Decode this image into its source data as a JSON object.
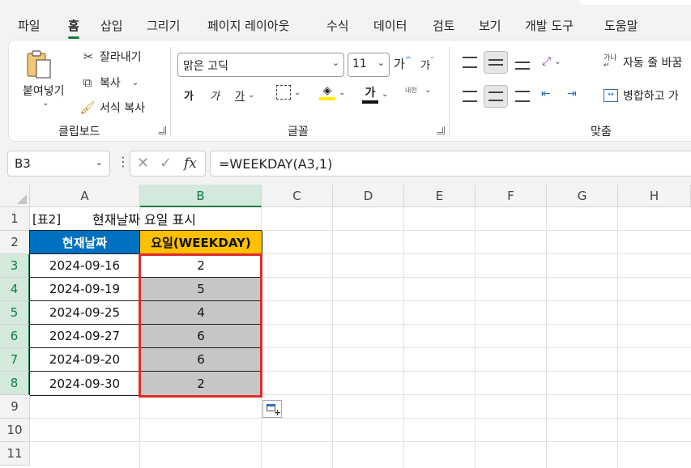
{
  "menu": {
    "tabs": [
      "파일",
      "홈",
      "삽입",
      "그리기",
      "페이지 레이아웃",
      "수식",
      "데이터",
      "검토",
      "보기",
      "개발 도구",
      "도움말"
    ],
    "active": "홈"
  },
  "ribbon": {
    "clipboard": {
      "paste": "붙여넣기",
      "cut": "잘라내기",
      "copy": "복사",
      "format_painter": "서식 복사",
      "group_label": "클립보드"
    },
    "font": {
      "font_name": "맑은 고딕",
      "font_size": "11",
      "bold": "가",
      "italic": "가",
      "underline": "가",
      "grow": "가",
      "shrink": "가",
      "font_color_glyph": "가",
      "phonetic": "내천",
      "group_label": "글꼴"
    },
    "alignment": {
      "wrap_text": "자동 줄 바꿈",
      "merge": "병합하고 가",
      "group_label": "맞춤"
    }
  },
  "formula_bar": {
    "name_box": "B3",
    "formula": "=WEEKDAY(A3,1)"
  },
  "grid": {
    "columns": [
      "A",
      "B",
      "C",
      "D",
      "E",
      "F",
      "G",
      "H"
    ],
    "rows": [
      "1",
      "2",
      "3",
      "4",
      "5",
      "6",
      "7",
      "8",
      "9",
      "10",
      "11"
    ],
    "title_label": "[표2]",
    "title_text": "현재날짜 요일 표시",
    "header_a": "현재날짜",
    "header_b": "요일(WEEKDAY)",
    "data": [
      {
        "date": "2024-09-16",
        "weekday": "2"
      },
      {
        "date": "2024-09-19",
        "weekday": "5"
      },
      {
        "date": "2024-09-25",
        "weekday": "4"
      },
      {
        "date": "2024-09-27",
        "weekday": "6"
      },
      {
        "date": "2024-09-20",
        "weekday": "6"
      },
      {
        "date": "2024-09-30",
        "weekday": "2"
      }
    ]
  },
  "colors": {
    "accent": "#107c41",
    "header_a_fill": "#0070c0",
    "header_b_fill": "#ffc000",
    "selection_border": "#e02b2b",
    "selection_fill": "#c6c6c6"
  }
}
